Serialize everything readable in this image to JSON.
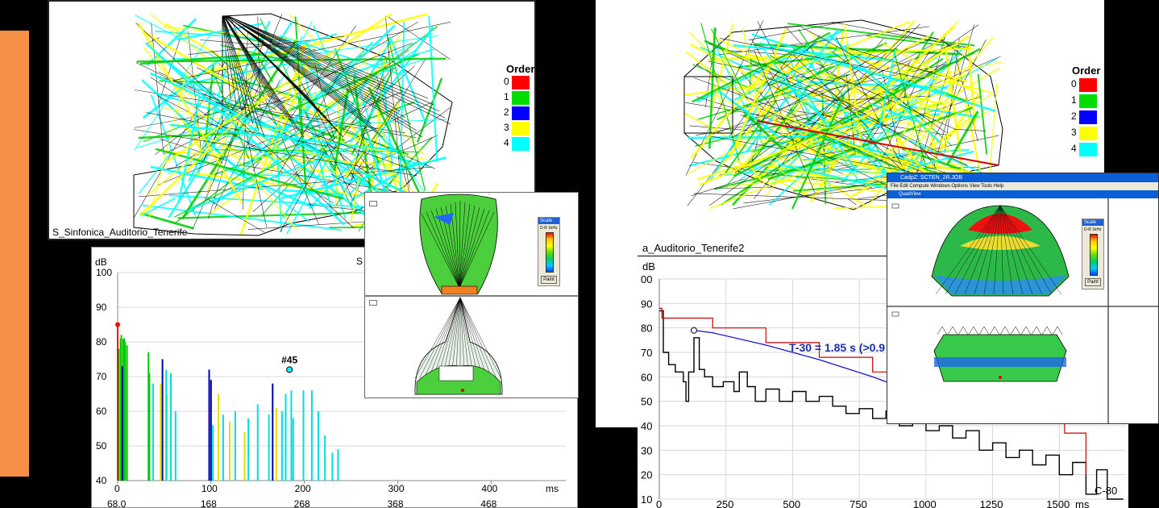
{
  "left_ray_view": {
    "caption": "S_Sinfonica_Auditorio_Tenerife",
    "legend_title": "Order",
    "legend": [
      {
        "order": "0",
        "color": "#ff0000"
      },
      {
        "order": "1",
        "color": "#00dd00"
      },
      {
        "order": "2",
        "color": "#0000ff"
      },
      {
        "order": "3",
        "color": "#ffff00"
      },
      {
        "order": "4",
        "color": "#00ffff"
      }
    ]
  },
  "right_ray_view": {
    "legend_title": "Order",
    "legend": [
      {
        "order": "0",
        "color": "#ff0000"
      },
      {
        "order": "1",
        "color": "#00dd00"
      },
      {
        "order": "2",
        "color": "#0000ff"
      },
      {
        "order": "3",
        "color": "#ffff00"
      },
      {
        "order": "4",
        "color": "#00ffff"
      }
    ]
  },
  "quadview_small": {
    "scale_title": "Scale",
    "scale_label": "D-R 1kHz",
    "paint_label": "Paint"
  },
  "quadview_large": {
    "title": "CadpZ: SCTEN_2R.JOB",
    "menu": "File   Edit   Compute   Windows   Options   View   Tools   Help",
    "subtitle": "QuadView",
    "scale_title": "Scale",
    "scale_label": "D-R 1kHz",
    "paint_label": "Paint"
  },
  "right_decay_caption": "a_Auditorio_Tenerife2",
  "cropped_header_letter": "S",
  "marker_label": "#45",
  "t30_label": "T-30 = 1.85 s (>0.9",
  "c80_label": "C-80",
  "chart_data": [
    {
      "type": "bar",
      "ylabel": "dB",
      "xlabel": "ms",
      "ylim": [
        40,
        100
      ],
      "xlim": [
        0,
        480
      ],
      "yticks": [
        "100",
        "90",
        "80",
        "70",
        "60",
        "50",
        "40"
      ],
      "xticks": [
        "0",
        "100",
        "200",
        "300",
        "400"
      ],
      "xticks_secondary": [
        "68.0",
        "168",
        "268",
        "368",
        "468"
      ],
      "marker": {
        "label": "#45",
        "x": 184,
        "y": 72
      },
      "direct": {
        "x": 0,
        "y": 85
      },
      "series": [
        {
          "order": "1",
          "color": "#00cc00",
          "reflections": [
            [
              1,
              78
            ],
            [
              3,
              81
            ],
            [
              4,
              82
            ],
            [
              6,
              81
            ],
            [
              7,
              81
            ],
            [
              8,
              80
            ],
            [
              10,
              79
            ],
            [
              33,
              77
            ],
            [
              34,
              71
            ]
          ]
        },
        {
          "order": "2",
          "color": "#0000aa",
          "reflections": [
            [
              5,
              73
            ],
            [
              48,
              75
            ],
            [
              98,
              72
            ],
            [
              100,
              69
            ],
            [
              166,
              68
            ]
          ]
        },
        {
          "order": "3",
          "color": "#e0e000",
          "reflections": [
            [
              46,
              68
            ],
            [
              53,
              65
            ],
            [
              108,
              65
            ],
            [
              120,
              57
            ],
            [
              136,
              54
            ],
            [
              170,
              61
            ]
          ]
        },
        {
          "order": "4",
          "color": "#00dddd",
          "reflections": [
            [
              38,
              68
            ],
            [
              52,
              72
            ],
            [
              57,
              71
            ],
            [
              62,
              60
            ],
            [
              102,
              56
            ],
            [
              113,
              59
            ],
            [
              126,
              60
            ],
            [
              140,
              58
            ],
            [
              150,
              62
            ],
            [
              162,
              59
            ],
            [
              176,
              60
            ],
            [
              180,
              65
            ],
            [
              186,
              66
            ],
            [
              188,
              58
            ],
            [
              199,
              66
            ],
            [
              208,
              66
            ],
            [
              215,
              60
            ],
            [
              222,
              53
            ],
            [
              230,
              48
            ],
            [
              236,
              49
            ]
          ]
        }
      ]
    },
    {
      "type": "line",
      "ylabel": "dB",
      "xlabel": "ms",
      "ylim": [
        10,
        100
      ],
      "xlim": [
        0,
        1750
      ],
      "yticks": [
        "00",
        "90",
        "80",
        "70",
        "60",
        "50",
        "40",
        "30",
        "20",
        "10"
      ],
      "xticks": [
        "0",
        "250",
        "500",
        "750",
        "1000",
        "1250",
        "1500"
      ],
      "series": [
        {
          "name": "",
          "color": "#000000",
          "points": [
            [
              0,
              87
            ],
            [
              15,
              70
            ],
            [
              35,
              65
            ],
            [
              60,
              62
            ],
            [
              90,
              58
            ],
            [
              100,
              50
            ],
            [
              110,
              62
            ],
            [
              130,
              76
            ],
            [
              150,
              63
            ],
            [
              170,
              60
            ],
            [
              200,
              56
            ],
            [
              240,
              58
            ],
            [
              280,
              54
            ],
            [
              300,
              62
            ],
            [
              330,
              56
            ],
            [
              360,
              50
            ],
            [
              400,
              55
            ],
            [
              450,
              50
            ],
            [
              500,
              54
            ],
            [
              550,
              50
            ],
            [
              600,
              52
            ],
            [
              650,
              48
            ],
            [
              700,
              45
            ],
            [
              750,
              47
            ],
            [
              800,
              43
            ],
            [
              850,
              46
            ],
            [
              900,
              40
            ],
            [
              950,
              44
            ],
            [
              1000,
              38
            ],
            [
              1050,
              40
            ],
            [
              1100,
              35
            ],
            [
              1150,
              38
            ],
            [
              1200,
              30
            ],
            [
              1250,
              33
            ],
            [
              1300,
              27
            ],
            [
              1350,
              30
            ],
            [
              1400,
              24
            ],
            [
              1450,
              28
            ],
            [
              1500,
              20
            ],
            [
              1550,
              25
            ],
            [
              1600,
              12
            ],
            [
              1640,
              22
            ],
            [
              1680,
              10
            ],
            [
              1740,
              10
            ]
          ]
        },
        {
          "name": "",
          "color": "#cc0000",
          "points": [
            [
              0,
              88
            ],
            [
              10,
              84
            ],
            [
              200,
              80
            ],
            [
              400,
              74
            ],
            [
              600,
              68
            ],
            [
              800,
              62
            ],
            [
              1000,
              55
            ],
            [
              1100,
              51
            ],
            [
              1200,
              46
            ],
            [
              1300,
              43
            ],
            [
              1450,
              42
            ],
            [
              1520,
              37
            ],
            [
              1600,
              20
            ]
          ]
        },
        {
          "name": "",
          "color": "#0000cc",
          "points": [
            [
              130,
              79
            ],
            [
              200,
              78
            ],
            [
              400,
              73
            ],
            [
              600,
              67
            ],
            [
              800,
              60
            ],
            [
              950,
              54
            ]
          ]
        }
      ]
    }
  ]
}
